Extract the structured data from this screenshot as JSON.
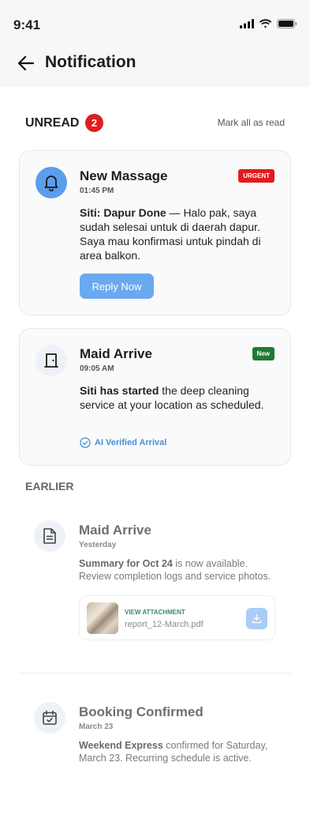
{
  "status_bar": {
    "time": "9:41"
  },
  "header": {
    "title": "Notification"
  },
  "unread": {
    "label": "UNREAD",
    "count": "2",
    "mark_all": "Mark all as read"
  },
  "cards": [
    {
      "icon": "bell-icon",
      "title": "New Massage",
      "time": "01:45 PM",
      "tag": "URGENT",
      "body_bold": "Siti: Dapur Done",
      "body_text": " — Halo pak, saya sudah selesai untuk di daerah dapur. Saya mau konfirmasi untuk pindah di area balkon.",
      "action": "Reply Now"
    },
    {
      "icon": "door-icon",
      "title": "Maid Arrive",
      "time": "09:05 AM",
      "tag": "New",
      "body_bold": "Siti has started",
      "body_text": " the deep cleaning service at your location as scheduled.",
      "verified": "AI Verified Arrival"
    }
  ],
  "earlier": {
    "label": "EARLIER",
    "items": [
      {
        "icon": "document-icon",
        "title": "Maid Arrive",
        "time": "Yesterday",
        "body_bold": "Summary for Oct 24",
        "body_text": " is now available. Review completion logs and service photos.",
        "attachment": {
          "label": "VIEW ATTACHMENT",
          "file": "report_12-March.pdf"
        }
      },
      {
        "icon": "calendar-check-icon",
        "title": "Booking Confirmed",
        "time": "March 23",
        "body_bold": "Weekend Express",
        "body_text": " confirmed for Saturday, March 23. Recurring schedule is active."
      }
    ]
  },
  "colors": {
    "accent": "#5b9ded",
    "urgent": "#e11d1d",
    "new": "#1f7a34",
    "verified": "#4a90d9"
  }
}
